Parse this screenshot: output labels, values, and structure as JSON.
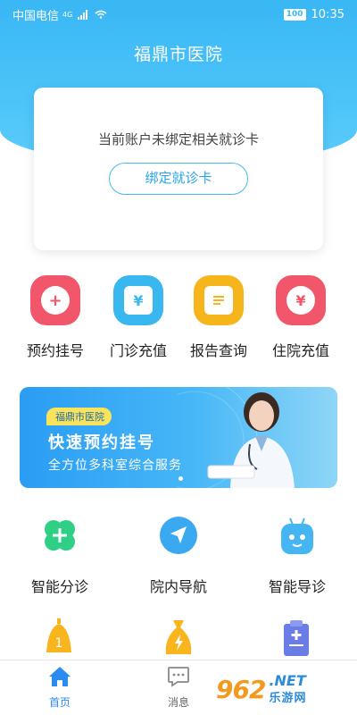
{
  "status_bar": {
    "carrier": "中国电信",
    "network": "4G",
    "battery": "100",
    "time": "10:35"
  },
  "header": {
    "title": "福鼎市医院"
  },
  "card": {
    "message": "当前账户未绑定相关就诊卡",
    "bind_button": "绑定就诊卡"
  },
  "quick_actions": [
    {
      "label": "预约挂号",
      "icon": "plus-circle-icon",
      "color": "#f2566a"
    },
    {
      "label": "门诊充值",
      "icon": "yuan-card-icon",
      "color": "#38b8ef"
    },
    {
      "label": "报告查询",
      "icon": "report-list-icon",
      "color": "#f7b51c"
    },
    {
      "label": "住院充值",
      "icon": "yuan-circle-icon",
      "color": "#f2566a"
    }
  ],
  "banner": {
    "tag": "福鼎市医院",
    "title": "快速预约挂号",
    "subtitle": "全方位多科室综合服务"
  },
  "services": [
    {
      "label": "智能分诊",
      "icon": "clover-plus-icon",
      "color": "#2fcf86"
    },
    {
      "label": "院内导航",
      "icon": "navigation-arrow-icon",
      "color": "#3aa9f0"
    },
    {
      "label": "智能导诊",
      "icon": "robot-icon",
      "color": "#46b6f2"
    }
  ],
  "partial_services": [
    {
      "icon": "bell-icon",
      "color": "#f8b51d"
    },
    {
      "icon": "money-bag-icon",
      "color": "#f8b51d"
    },
    {
      "icon": "clipboard-plus-icon",
      "color": "#6a7de6"
    }
  ],
  "tab_bar": {
    "active_color": "#2a8cf0",
    "tabs": [
      {
        "label": "首页",
        "icon": "home-icon"
      },
      {
        "label": "消息",
        "icon": "message-icon"
      }
    ]
  },
  "watermark": {
    "logo": "962",
    "net": ".NET",
    "cn": "乐游网"
  }
}
